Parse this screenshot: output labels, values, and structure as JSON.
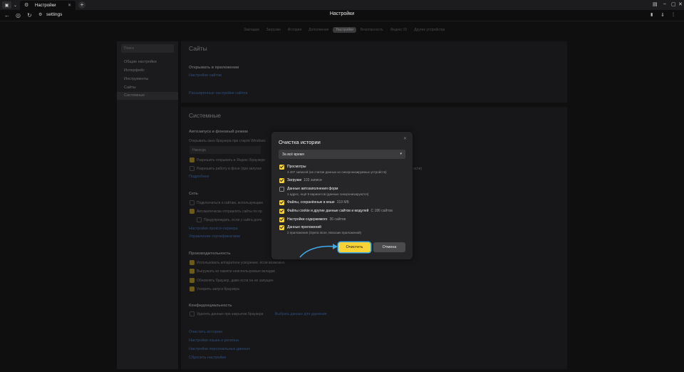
{
  "browser": {
    "tab_title": "Настройки",
    "address": "settings",
    "page_title": "Настройки"
  },
  "topnav": {
    "items": [
      "Закладки",
      "Загрузки",
      "История",
      "Дополнения",
      "Настройки",
      "Безопасность",
      "Яндекс ID",
      "Другие устройства"
    ],
    "active": "Настройки"
  },
  "sidebar": {
    "search_placeholder": "Поиск",
    "items": [
      {
        "label": "Общие настройки"
      },
      {
        "label": "Интерфейс"
      },
      {
        "label": "Инструменты"
      },
      {
        "label": "Сайты"
      },
      {
        "label": "Системные"
      }
    ],
    "active": "Системные"
  },
  "sites": {
    "title": "Сайты",
    "open_in_app": "Открывать в приложении",
    "site_settings_link": "Настройки сайтов",
    "advanced_link": "Расширенные настройки сайтов"
  },
  "system": {
    "title": "Системные",
    "autostart_heading": "Автозапуск и фоновый режим",
    "autostart_text": "Открывать окно браузера при старте Windows",
    "autostart_value": "Никогда",
    "allow_open_yandex": "Разрешить открывать в Яндекс Браузере",
    "allow_background": "Разрешить работу в фоне (при запуске",
    "background_suffix": "ости)",
    "more_link": "Подробнее",
    "network_heading": "Сеть",
    "network_items": [
      "Подключаться к сайтам, использующим",
      "Автоматически отправлять сайты по пр",
      "Предупреждать, если у сайта доло"
    ],
    "proxy_link": "Настройки прокси-сервера",
    "certs_link": "Управление сертификатами",
    "perf_heading": "Производительность",
    "perf_items": [
      "Использовать аппаратное ускорение, если возможно",
      "Выгружать из памяти неиспользуемые вкладки",
      "Обновлять браузер, даже если он не запущен",
      "Ускорять запуск браузера"
    ],
    "privacy_heading": "Конфиденциальность",
    "privacy_item": "Удалять данные при закрытии браузера",
    "privacy_link": "Выбрать данные для удаления",
    "links": [
      "Очистить историю",
      "Настройки языка и региона",
      "Настройки персональных данных",
      "Сбросить настройки"
    ]
  },
  "dialog": {
    "title": "Очистка истории",
    "period": "За всё время",
    "items": [
      {
        "label": "Просмотры",
        "count": "",
        "sub": "3 407 записей (не считая данных из синхронизируемых устройств)",
        "checked": true
      },
      {
        "label": "Загрузки",
        "count": "103 записи",
        "sub": "",
        "checked": true
      },
      {
        "label": "Данные автозаполнения форм",
        "count": "",
        "sub": "1 адрес, ещё 9 вариантов (данные синхронизируются)",
        "checked": false
      },
      {
        "label": "Файлы, сохранённые в кеше",
        "count": "319 МБ",
        "sub": "",
        "checked": true
      },
      {
        "label": "Файлы cookie и другие данные сайтов и модулей",
        "count": "С 186 сайтов",
        "sub": "",
        "checked": true
      },
      {
        "label": "Настройки содержимого",
        "count": "36 сайтов",
        "sub": "",
        "checked": true
      },
      {
        "label": "Данные приложений",
        "count": "",
        "sub": "2 приложения (Opera store, Магазин приложений)",
        "checked": true
      }
    ],
    "clear_label": "Очистить",
    "cancel_label": "Отмена"
  },
  "colors": {
    "accent": "#f7d338",
    "focus_ring": "#3ea7e6",
    "arrow": "#3ea7e6"
  }
}
